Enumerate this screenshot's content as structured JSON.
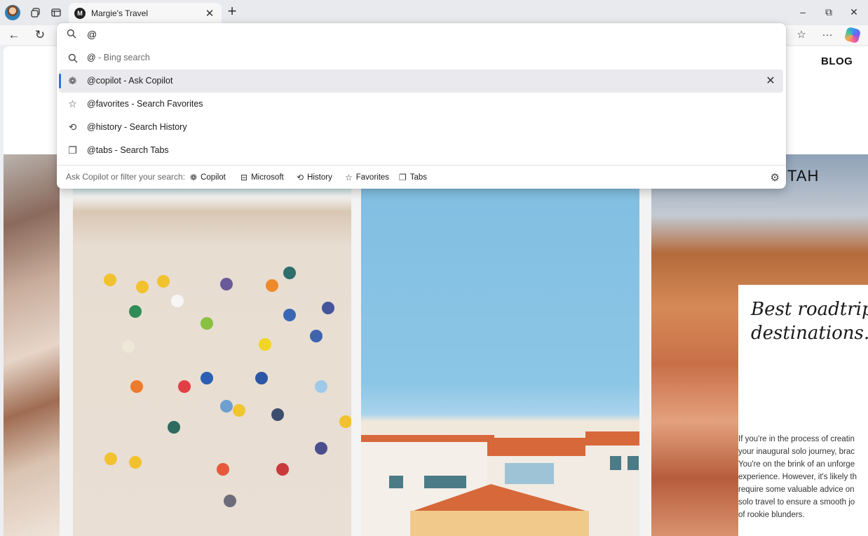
{
  "window": {
    "tab_title": "Margie's Travel",
    "favicon_letter": "M",
    "close_tab_glyph": "✕",
    "new_tab_glyph": "+",
    "minimize_glyph": "–",
    "restore_glyph": "⧉",
    "close_glyph": "✕"
  },
  "toolbar": {
    "back_glyph": "←",
    "refresh_glyph": "↻",
    "favorites_glyph": "☆",
    "more_glyph": "···"
  },
  "omnibox": {
    "query": "@",
    "suggestions": [
      {
        "label": "@",
        "detail": " - Bing search",
        "icon": "search-icon",
        "glyph": "⌕"
      },
      {
        "label": "@copilot - Ask Copilot",
        "detail": "",
        "icon": "copilot-icon",
        "glyph": "❁"
      },
      {
        "label": "@favorites - Search Favorites",
        "detail": "",
        "icon": "star-icon",
        "glyph": "☆"
      },
      {
        "label": "@history - Search History",
        "detail": "",
        "icon": "history-icon",
        "glyph": "⟲"
      },
      {
        "label": "@tabs - Search Tabs",
        "detail": "",
        "icon": "tabs-icon",
        "glyph": "❐"
      }
    ],
    "remove_glyph": "✕",
    "filter_prompt": "Ask Copilot or filter your search:",
    "filters": [
      {
        "label": "Copilot",
        "glyph": "❁"
      },
      {
        "label": "Microsoft",
        "glyph": "⊟"
      },
      {
        "label": "History",
        "glyph": "⟲"
      },
      {
        "label": "Favorites",
        "glyph": "☆"
      },
      {
        "label": "Tabs",
        "glyph": "❐"
      }
    ],
    "settings_glyph": "⚙"
  },
  "page": {
    "nav_blog": "BLOG",
    "section_heading": "TAH",
    "card_title_line1": "Best roadtrip",
    "card_title_line2": "destinations...",
    "card_body": [
      "If you're in the process of creatin",
      "your inaugural solo journey, brac",
      "You're on the brink of an unforge",
      "experience. However, it's likely th",
      "require some valuable advice on",
      "solo travel to ensure a smooth jo",
      "of rookie blunders."
    ]
  },
  "colors": {
    "accent": "#2f6fdf",
    "chrome": "#e8eaed",
    "toolbar": "#f7f7f8"
  }
}
